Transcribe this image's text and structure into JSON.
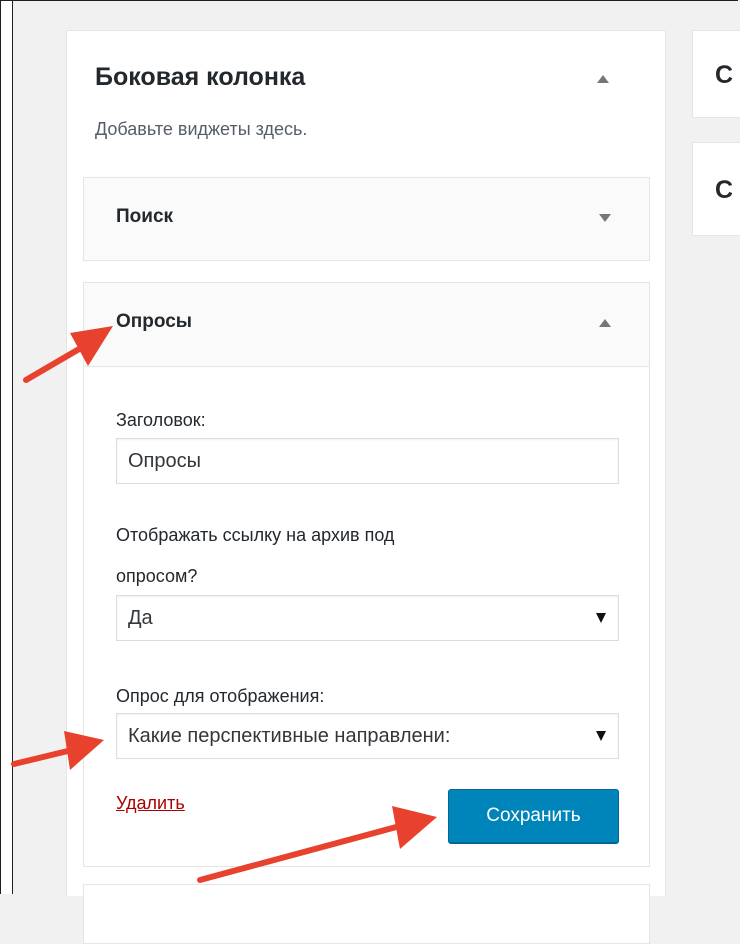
{
  "sidebar": {
    "title": "Боковая колонка",
    "description": "Добавьте виджеты здесь."
  },
  "widgets": {
    "search": {
      "title": "Поиск"
    },
    "polls": {
      "title": "Опросы",
      "title_label": "Заголовок:",
      "title_value": "Опросы",
      "archive_label_line1": "Отображать ссылку на архив под",
      "archive_label_line2": "опросом?",
      "archive_value": "Да",
      "poll_label": "Опрос для отображения:",
      "poll_value": "Какие перспективные направлени:",
      "delete_label": "Удалить",
      "save_label": "Сохранить"
    }
  },
  "right_column": {
    "card1_letter": "С",
    "card2_letter": "С"
  },
  "colors": {
    "primary_button": "#0085ba",
    "delete_link": "#aa0000",
    "annotation_arrow": "#e8412d"
  },
  "icons": [
    "chevron-up-icon",
    "chevron-down-icon",
    "select-arrow-icon",
    "annotation-arrow-icon"
  ]
}
